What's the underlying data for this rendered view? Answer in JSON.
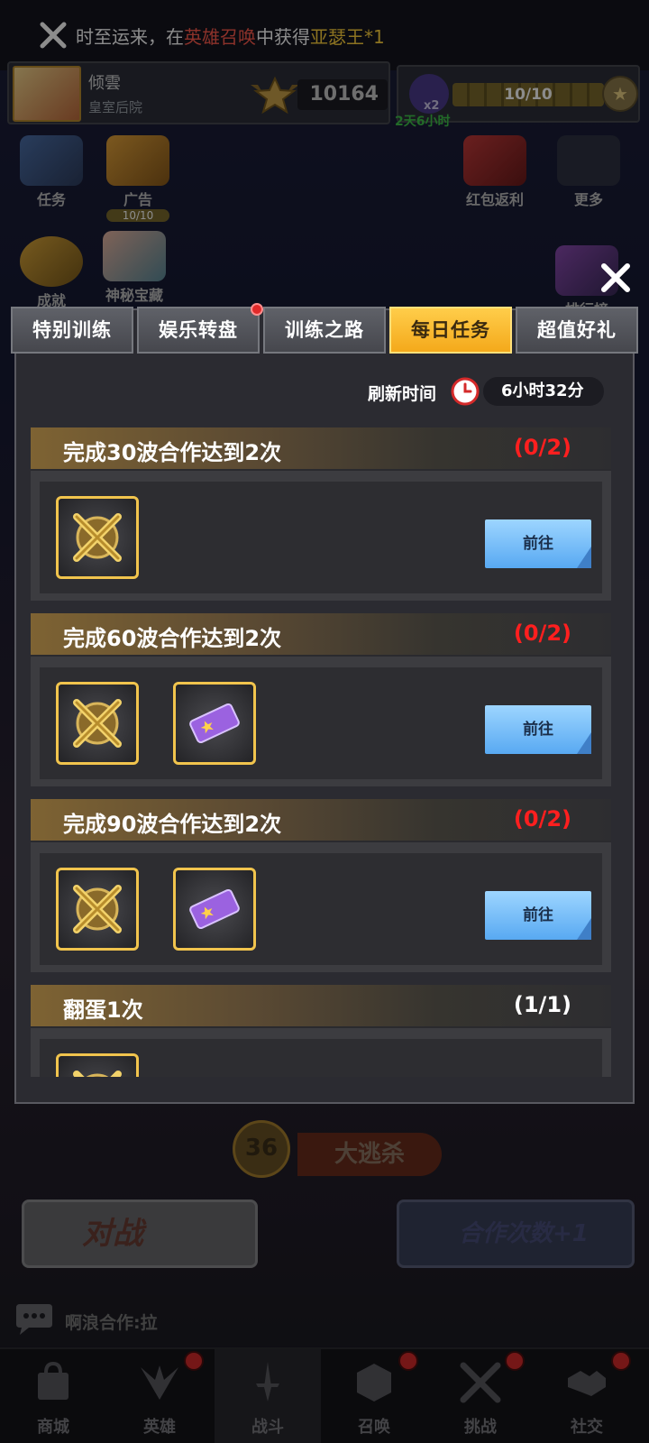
{
  "notice": {
    "prefix": "时至运来，在",
    "highlight1": "英雄召唤",
    "middle": "中获得",
    "highlight2": "亚瑟王*1"
  },
  "player": {
    "name": "倾雲",
    "guild": "皇室后院",
    "trophies": "10164",
    "energy": "10/10",
    "energy_fraction": 1.0,
    "multiplier": "x2",
    "timer": "2天6小时"
  },
  "side_icons": {
    "task": "任务",
    "ad": "广告",
    "ad_count": "10/10",
    "redpacket": "红包返利",
    "more": "更多",
    "achievement": "成就",
    "treasure": "神秘宝藏",
    "ranking": "排行榜"
  },
  "tabs": [
    {
      "label": "特别训练",
      "active": false
    },
    {
      "label": "娱乐转盘",
      "active": false,
      "badge": true
    },
    {
      "label": "训练之路",
      "active": false
    },
    {
      "label": "每日任务",
      "active": true
    },
    {
      "label": "超值好礼",
      "active": false
    }
  ],
  "refresh": {
    "label": "刷新时间",
    "time": "6小时32分"
  },
  "tasks": [
    {
      "title": "完成30波合作达到2次",
      "progress": "(0/2)",
      "button": "前往",
      "rewards": [
        "swords-shield-icon"
      ]
    },
    {
      "title": "完成60波合作达到2次",
      "progress": "(0/2)",
      "button": "前往",
      "rewards": [
        "swords-shield-icon",
        "purple-ticket-icon"
      ]
    },
    {
      "title": "完成90波合作达到2次",
      "progress": "(0/2)",
      "button": "前往",
      "rewards": [
        "swords-shield-icon",
        "purple-ticket-icon"
      ]
    },
    {
      "title": "翻蛋1次",
      "progress": "(1/1)",
      "button": "",
      "rewards": [
        "swords-shield-icon"
      ]
    }
  ],
  "mode": {
    "level": "36",
    "name": "大逃杀"
  },
  "buttons": {
    "battle": "对战",
    "coop": "合作次数+1"
  },
  "chat": {
    "text": "啊浪合作:拉"
  },
  "nav": [
    {
      "label": "商城",
      "badge": false
    },
    {
      "label": "英雄",
      "badge": true
    },
    {
      "label": "战斗",
      "badge": false,
      "active": true
    },
    {
      "label": "召唤",
      "badge": true
    },
    {
      "label": "挑战",
      "badge": true
    },
    {
      "label": "社交",
      "badge": true
    }
  ],
  "colors": {
    "accent_gold": "#f4a91b",
    "progress_red": "#ff1f1f",
    "go_button_blue": "#58a9f2",
    "highlight_red": "#ff5b4d",
    "highlight_yellow": "#ffd23c"
  }
}
